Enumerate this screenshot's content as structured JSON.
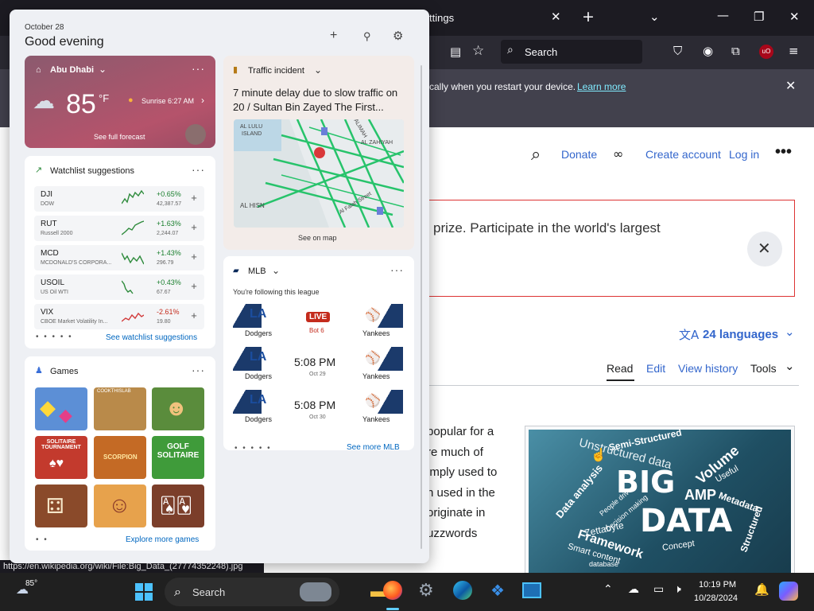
{
  "browser": {
    "tab_title": "ttings",
    "search_placeholder": "Search",
    "notice_text": "cally when you restart your device.",
    "notice_link": "Learn more",
    "status_url": "https://en.wikipedia.org/wiki/File:Big_Data_(27774352248).jpg"
  },
  "wiki": {
    "donate": "Donate",
    "create_account": "Create account",
    "log_in": "Log in",
    "banner_text": "prize. Participate in the world's largest",
    "languages": "24 languages",
    "tabs": [
      "Read",
      "Edit",
      "View history",
      "Tools"
    ],
    "body_lines": [
      "popular for a",
      "re much of",
      "imply used to",
      "n used in the",
      "originate in",
      "uzzwords"
    ],
    "image_words": [
      "Semi-Structured",
      "Unstructured data",
      "BIG",
      "DATA",
      "Volume",
      "Useful",
      "Metadata",
      "AMP",
      "Zettabyte",
      "Framework",
      "Smart content",
      "Concept",
      "Data analysis",
      "People driven",
      "Decision making",
      "database",
      "Structured"
    ]
  },
  "panel": {
    "date": "October 28",
    "greeting": "Good evening",
    "weather": {
      "location": "Abu Dhabi",
      "temp": "85",
      "unit": "°F",
      "sunrise": "Sunrise 6:27 AM",
      "forecast_link": "See full forecast"
    },
    "traffic": {
      "header": "Traffic incident",
      "text": "7 minute delay due to slow traffic on 20 / Sultan Bin Zayed The First...",
      "map_labels": [
        "AL LULU",
        "ISLAND",
        "AL ZAHIYAH",
        "AL HISN",
        "Al Falah Street",
        "ALIMAH"
      ],
      "map_link": "See on map"
    },
    "watchlist": {
      "title": "Watchlist suggestions",
      "link": "See watchlist suggestions",
      "items": [
        {
          "symbol": "DJI",
          "name": "DOW",
          "change": "+0.65%",
          "price": "42,387.57",
          "up": true
        },
        {
          "symbol": "RUT",
          "name": "Russell 2000",
          "change": "+1.63%",
          "price": "2,244.07",
          "up": true
        },
        {
          "symbol": "MCD",
          "name": "MCDONALD'S CORPORA...",
          "change": "+1.43%",
          "price": "296.79",
          "up": true
        },
        {
          "symbol": "USOIL",
          "name": "US Oil WTI",
          "change": "+0.43%",
          "price": "67.67",
          "up": true
        },
        {
          "symbol": "VIX",
          "name": "CBOE Market Volatility In...",
          "change": "-2.61%",
          "price": "19.80",
          "up": false
        }
      ]
    },
    "mlb": {
      "title": "MLB",
      "subtitle": "You're following this league",
      "link": "See more MLB",
      "games": [
        {
          "home": "Dodgers",
          "away": "Yankees",
          "status": "LIVE",
          "detail": "Bot 6"
        },
        {
          "home": "Dodgers",
          "away": "Yankees",
          "status": "5:08 PM",
          "detail": "Oct 29"
        },
        {
          "home": "Dodgers",
          "away": "Yankees",
          "status": "5:08 PM",
          "detail": "Oct 30"
        }
      ]
    },
    "games": {
      "title": "Games",
      "link": "Explore more games",
      "tiles": [
        {
          "label": "",
          "color": "#5c8fd6"
        },
        {
          "label": "COOKTHISLAB",
          "color": "#b98a4a"
        },
        {
          "label": "",
          "color": "#5a8c3c"
        },
        {
          "label": "SOLITAIRE TOURNAMENT",
          "color": "#c33a2d"
        },
        {
          "label": "SCORPION",
          "color": "#c46a25"
        },
        {
          "label": "GOLF SOLITAIRE",
          "color": "#3f9b3a"
        },
        {
          "label": "",
          "color": "#8a4a2a"
        },
        {
          "label": "",
          "color": "#e7a24c"
        },
        {
          "label": "",
          "color": "#7b3e2a"
        }
      ]
    }
  },
  "taskbar": {
    "weather_temp": "85°",
    "search": "Search",
    "time": "10:19 PM",
    "date": "10/28/2024"
  }
}
